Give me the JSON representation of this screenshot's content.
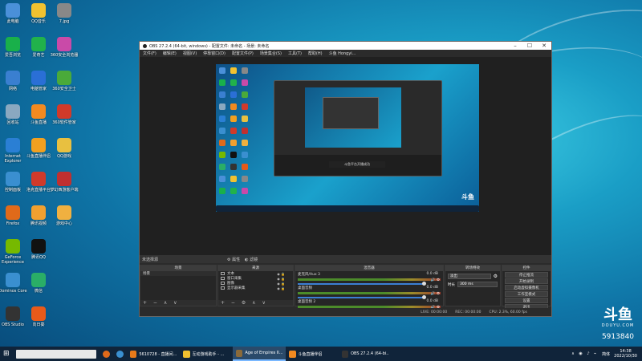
{
  "desktop_icons": [
    {
      "label": "此电脑",
      "color": "#4a90d9"
    },
    {
      "label": "QQ音乐",
      "color": "#f2c230"
    },
    {
      "label": "7.jpg",
      "color": "#888888"
    },
    {
      "label": "爱吾浏览",
      "color": "#19b04a"
    },
    {
      "label": "爱奇艺",
      "color": "#21b24b"
    },
    {
      "label": "360安全浏览器",
      "color": "#c94aa8"
    },
    {
      "label": "网络",
      "color": "#3a7fd0"
    },
    {
      "label": "电脑管家",
      "color": "#2a6fd6"
    },
    {
      "label": "360安全卫士",
      "color": "#4aaa3a"
    },
    {
      "label": "回收站",
      "color": "#8aa8c0"
    },
    {
      "label": "斗鱼直播",
      "color": "#f28a20"
    },
    {
      "label": "360软件管家",
      "color": "#d13a2a"
    },
    {
      "label": "Internet Explorer",
      "color": "#2a7fd4"
    },
    {
      "label": "斗鱼直播伴侣",
      "color": "#f2a020"
    },
    {
      "label": "QQ游戏",
      "color": "#e8c040"
    },
    {
      "label": "控制面板",
      "color": "#3a8fd0"
    },
    {
      "label": "洛克直播平台",
      "color": "#d03a2a"
    },
    {
      "label": "梦幻西游客户端",
      "color": "#c03030"
    },
    {
      "label": "Firefox",
      "color": "#e06a1a"
    },
    {
      "label": "腾讯视频",
      "color": "#f0a030"
    },
    {
      "label": "游戏中心",
      "color": "#f0b040"
    },
    {
      "label": "GeForce Experience",
      "color": "#76b900"
    },
    {
      "label": "腾讯QQ",
      "color": "#111111"
    },
    {
      "label": "Dominos Core",
      "color": "#3a8fd0"
    },
    {
      "label": "微信",
      "color": "#2aae67"
    },
    {
      "label": "OBS Studio",
      "color": "#333333"
    },
    {
      "label": "向日葵",
      "color": "#e85a1a"
    }
  ],
  "obs": {
    "title": "OBS 27.2.4 (64-bit, windows) - 配置文件: 未命名 - 场景: 未命名",
    "menu": [
      "文件(F)",
      "编辑(E)",
      "视图(V)",
      "停靠窗口(D)",
      "配置文件(P)",
      "场景集合(S)",
      "工具(T)",
      "帮助(H)",
      "斗鱼 Hongyi..."
    ],
    "scene_bar": "未选择源",
    "scene_bar_props": "属性",
    "scene_bar_filters": "滤镜",
    "panels": {
      "scenes": {
        "header": "场景",
        "items": [
          "场景"
        ]
      },
      "sources": {
        "header": "来源",
        "items": [
          "文本",
          "窗口采集",
          "图像",
          "显示器采集"
        ]
      },
      "mixer": {
        "header": "混音器",
        "rows": [
          {
            "name": "麦克风/Aux 3",
            "db": "0.0 dB"
          },
          {
            "name": "桌面音频",
            "db": "0.0 dB"
          },
          {
            "name": "桌面音频 2",
            "db": "0.0 dB"
          }
        ]
      },
      "transitions": {
        "header": "转场特效",
        "type": "淡出",
        "duration_label": "时长",
        "duration": "300 ms"
      },
      "controls": {
        "header": "控件",
        "buttons": [
          "停止推流",
          "开始录制",
          "启动虚拟摄像机",
          "工作室模式",
          "设置",
          "退出"
        ]
      }
    },
    "foot_controls": "+ − ∧ ∨",
    "status": {
      "live": "LIVE: 00:00:00",
      "rec": "REC: 00:00:00",
      "cpu": "CPU: 2.3%, 60.00 fps"
    },
    "inner_caption": "斗鱼平台开播成功"
  },
  "taskbar": {
    "items": [
      {
        "label": "5610728 - 直播间...",
        "color": "#e87a1a"
      },
      {
        "label": "互动游戏助手 - ...",
        "color": "#f0c030"
      },
      {
        "label": "Age of Empires II...",
        "color": "#8a6a3a"
      },
      {
        "label": "斗鱼直播伴侣",
        "color": "#f28a20"
      },
      {
        "label": "OBS 27.2.4 (64-bi...",
        "color": "#333333"
      }
    ],
    "clock_time": "14:38",
    "clock_date": "2022/10/30",
    "lang": "简体"
  },
  "douyu": {
    "logo": "斗鱼",
    "sub": "DOUYU.COM",
    "room": "5913840"
  }
}
